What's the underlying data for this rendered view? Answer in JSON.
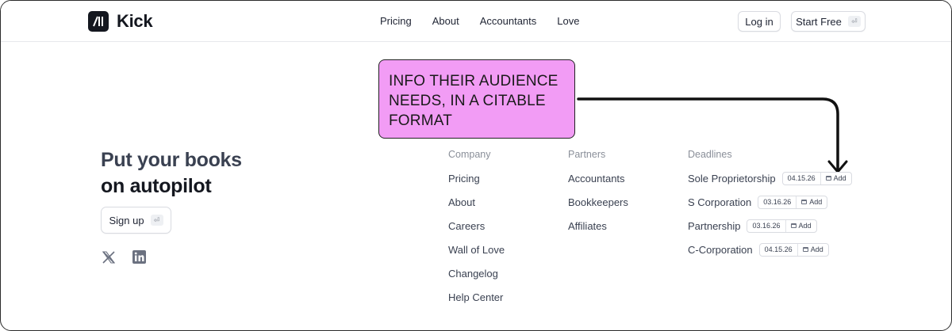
{
  "brand": {
    "name": "Kick",
    "logo_glyph": "/||"
  },
  "nav": {
    "items": [
      "Pricing",
      "About",
      "Accountants",
      "Love"
    ]
  },
  "header_actions": {
    "login_label": "Log in",
    "start_label": "Start Free",
    "start_kbd": "⏎"
  },
  "callout": {
    "text": "INFO THEIR AUDIENCE NEEDS, IN A CITABLE FORMAT",
    "color": "#f29cf5"
  },
  "hero": {
    "line1": "Put your books",
    "line2": "on autopilot"
  },
  "signup": {
    "label": "Sign up",
    "kbd": "⏎"
  },
  "socials": [
    {
      "icon": "x-icon"
    },
    {
      "icon": "linkedin-icon"
    }
  ],
  "footer": {
    "company": {
      "heading": "Company",
      "items": [
        "Pricing",
        "About",
        "Careers",
        "Wall of Love",
        "Changelog",
        "Help Center"
      ]
    },
    "partners": {
      "heading": "Partners",
      "items": [
        "Accountants",
        "Bookkeepers",
        "Affiliates"
      ]
    },
    "deadlines": {
      "heading": "Deadlines",
      "items": [
        {
          "label": "Sole Proprietorship",
          "date": "04.15.26",
          "action": "Add"
        },
        {
          "label": "S Corporation",
          "date": "03.16.26",
          "action": "Add"
        },
        {
          "label": "Partnership",
          "date": "03.16.26",
          "action": "Add"
        },
        {
          "label": "C-Corporation",
          "date": "04.15.26",
          "action": "Add"
        }
      ]
    }
  }
}
